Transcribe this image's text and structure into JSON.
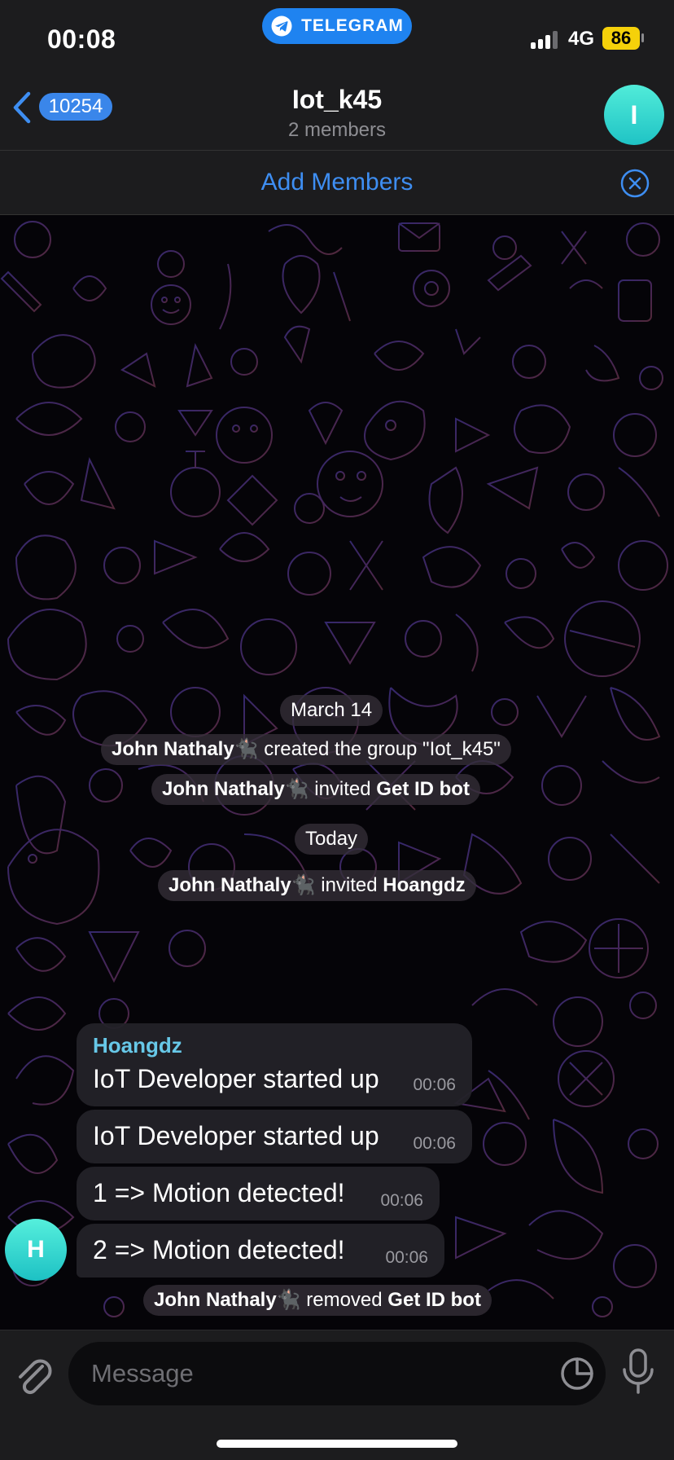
{
  "status_bar": {
    "time": "00:08",
    "app_pill_label": "TELEGRAM",
    "network": "4G",
    "battery": "86"
  },
  "header": {
    "back_count": "10254",
    "title": "Iot_k45",
    "subtitle": "2 members",
    "avatar_letter": "I"
  },
  "banner": {
    "label": "Add Members"
  },
  "date_separators": [
    "March 14",
    "Today"
  ],
  "service_messages": {
    "created": {
      "actor": "John Nathaly🐈‍⬛",
      "text": "created the group \"Iot_k45\""
    },
    "invited_bot": {
      "actor": "John Nathaly🐈‍⬛",
      "verb": "invited",
      "target": "Get ID bot"
    },
    "invited_user": {
      "actor": "John Nathaly🐈‍⬛",
      "verb": "invited",
      "target": "Hoangdz"
    },
    "removed_bot": {
      "actor": "John Nathaly🐈‍⬛",
      "verb": "removed",
      "target": "Get ID bot"
    }
  },
  "messages": [
    {
      "sender": "Hoangdz",
      "text": "IoT Developer started up",
      "time": "00:06"
    },
    {
      "text": "IoT Developer started up",
      "time": "00:06"
    },
    {
      "text": "1 => Motion detected!",
      "time": "00:06"
    },
    {
      "text": "2 => Motion detected!",
      "time": "00:06"
    }
  ],
  "sender_avatar_letter": "H",
  "composer": {
    "placeholder": "Message"
  },
  "colors": {
    "accent": "#3e8ef2",
    "telegram_blue": "#1f83f0",
    "avatar_teal": "#2fd3cc",
    "sender_name": "#67c8e8",
    "battery_yellow": "#f5d10a"
  },
  "icons": [
    "telegram-plane-icon",
    "back-chevron-icon",
    "close-circle-icon",
    "paperclip-icon",
    "sticker-icon",
    "microphone-icon"
  ]
}
